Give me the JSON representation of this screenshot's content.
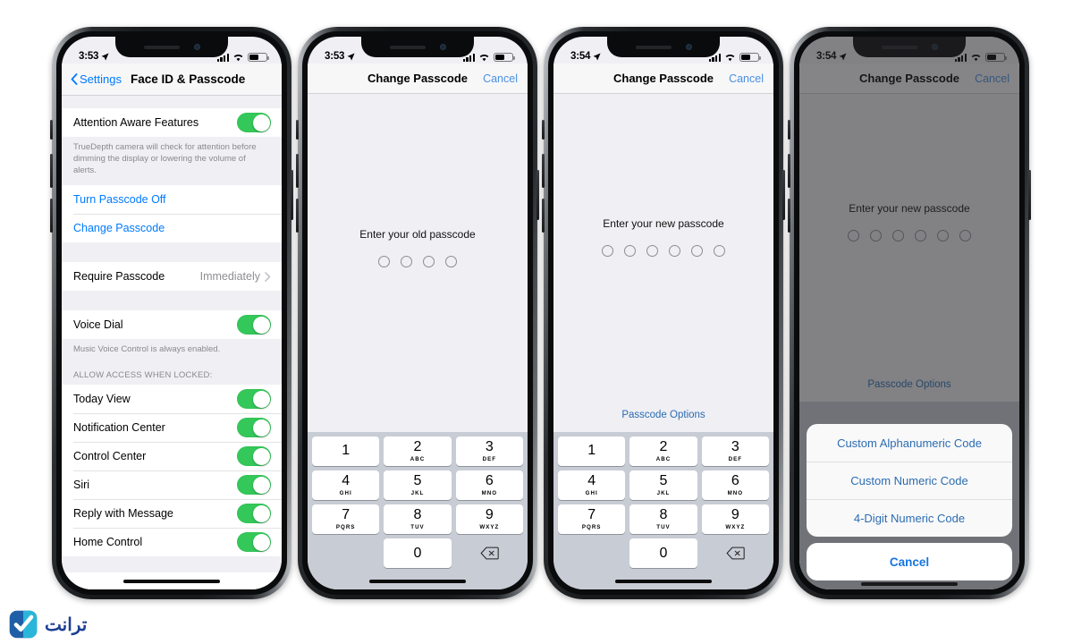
{
  "phones": [
    {
      "id": "settings",
      "status": {
        "time": "3:53",
        "location_icon": "location-arrow-icon",
        "signal_icon": "cellular-bars-icon",
        "wifi_icon": "wifi-icon",
        "battery_icon": "battery-icon"
      },
      "nav": {
        "back_label": "Settings",
        "title": "Face ID & Passcode"
      },
      "groups": [
        {
          "rows": [
            {
              "label": "Attention Aware Features",
              "type": "toggle",
              "on": true
            }
          ],
          "footnote": "TrueDepth camera will check for attention before dimming the display or lowering the volume of alerts."
        },
        {
          "rows": [
            {
              "label": "Turn Passcode Off",
              "type": "link"
            },
            {
              "label": "Change Passcode",
              "type": "link"
            }
          ]
        },
        {
          "rows": [
            {
              "label": "Require Passcode",
              "type": "value",
              "value": "Immediately"
            }
          ]
        },
        {
          "rows": [
            {
              "label": "Voice Dial",
              "type": "toggle",
              "on": true
            }
          ],
          "footnote": "Music Voice Control is always enabled."
        },
        {
          "header": "ALLOW ACCESS WHEN LOCKED:",
          "rows": [
            {
              "label": "Today View",
              "type": "toggle",
              "on": true
            },
            {
              "label": "Notification Center",
              "type": "toggle",
              "on": true
            },
            {
              "label": "Control Center",
              "type": "toggle",
              "on": true
            },
            {
              "label": "Siri",
              "type": "toggle",
              "on": true
            },
            {
              "label": "Reply with Message",
              "type": "toggle",
              "on": true
            },
            {
              "label": "Home Control",
              "type": "toggle",
              "on": true
            }
          ]
        }
      ]
    },
    {
      "id": "old-passcode",
      "status": {
        "time": "3:53"
      },
      "nav": {
        "title": "Change Passcode",
        "cancel_label": "Cancel"
      },
      "prompt": "Enter your old passcode",
      "dot_count": 4,
      "keypad": [
        {
          "digit": "1",
          "letters": ""
        },
        {
          "digit": "2",
          "letters": "ABC"
        },
        {
          "digit": "3",
          "letters": "DEF"
        },
        {
          "digit": "4",
          "letters": "GHI"
        },
        {
          "digit": "5",
          "letters": "JKL"
        },
        {
          "digit": "6",
          "letters": "MNO"
        },
        {
          "digit": "7",
          "letters": "PQRS"
        },
        {
          "digit": "8",
          "letters": "TUV"
        },
        {
          "digit": "9",
          "letters": "WXYZ"
        },
        {
          "digit": "0",
          "letters": ""
        }
      ],
      "delete_icon": "backspace-icon"
    },
    {
      "id": "new-passcode",
      "status": {
        "time": "3:54"
      },
      "nav": {
        "title": "Change Passcode",
        "cancel_label": "Cancel"
      },
      "prompt": "Enter your new passcode",
      "dot_count": 6,
      "options_label": "Passcode Options"
    },
    {
      "id": "passcode-options",
      "status": {
        "time": "3:54"
      },
      "nav": {
        "title": "Change Passcode",
        "cancel_label": "Cancel"
      },
      "prompt": "Enter your new passcode",
      "dot_count": 6,
      "options_label": "Passcode Options",
      "sheet": {
        "items": [
          "Custom Alphanumeric Code",
          "Custom Numeric Code",
          "4-Digit Numeric Code"
        ],
        "cancel_label": "Cancel"
      }
    }
  ],
  "watermark": {
    "text": "ترانت",
    "badge_icon": "check-badge-icon"
  },
  "colors": {
    "toggle_on": "#34c759",
    "link_blue": "#007aff",
    "sheet_blue": "#2b6cb0",
    "screen_bg": "#efeff4",
    "keypad_bg": "#c8ccd4"
  }
}
